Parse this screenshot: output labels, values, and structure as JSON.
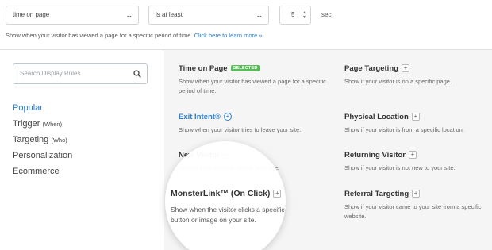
{
  "top": {
    "condition_select": "time on page",
    "operator_select": "is at least",
    "number_value": "5",
    "unit": "sec.",
    "helper_text": "Show when your visitor has viewed a page for a specific period of time.",
    "helper_link": "Click here to learn more »"
  },
  "sidebar": {
    "search_placeholder": "Search Display Rules",
    "categories": [
      {
        "label": "Popular",
        "sub": ""
      },
      {
        "label": "Trigger",
        "sub": "(When)"
      },
      {
        "label": "Targeting",
        "sub": "(Who)"
      },
      {
        "label": "Personalization",
        "sub": ""
      },
      {
        "label": "Ecommerce",
        "sub": ""
      }
    ]
  },
  "rules": [
    {
      "title": "Time on Page",
      "badge": "SELECTED",
      "desc": "Show when your visitor has viewed a page for a specific period of time."
    },
    {
      "title": "Page Targeting",
      "desc": "Show if your visitor is on a specific page."
    },
    {
      "title": "Exit Intent®",
      "desc": "Show when your visitor tries to leave your site."
    },
    {
      "title": "Physical Location",
      "desc": "Show if your visitor is from a specific location."
    },
    {
      "title": "New Visitor",
      "desc": "Show if your visitor is new to your site."
    },
    {
      "title": "Returning Visitor",
      "desc": "Show if your visitor is not new to your site."
    },
    {
      "title": "MonsterLink™ (On Click)",
      "desc": "Show when the visitor clicks a specific link, button or image on your site."
    },
    {
      "title": "Referral Targeting",
      "desc": "Show if your visitor came to your site from a specific website."
    }
  ],
  "colors": {
    "accent": "#2a7ed3",
    "badge": "#5cb85c",
    "main_bg": "#f5f5f5"
  },
  "icons": {
    "search": "search-icon",
    "add": "plus-icon",
    "dropdown": "chevron-down-icon"
  }
}
